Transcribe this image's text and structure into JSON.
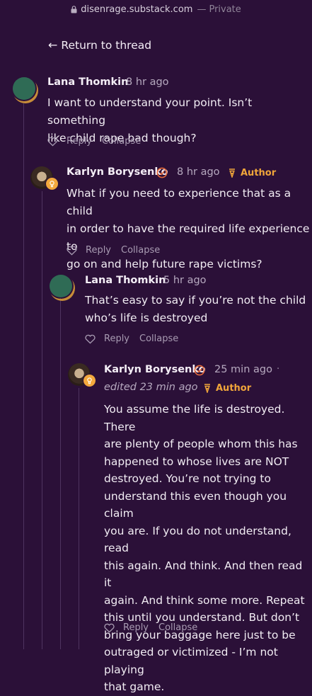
{
  "browser": {
    "domain": "disenrage.substack.com",
    "separator": "—",
    "privacy": "Private"
  },
  "nav": {
    "back_label": "Return to thread"
  },
  "comments": [
    {
      "author": "Lana Thomkin",
      "time": "8 hr ago",
      "lines": [
        "I want to understand your point. Isn’t something",
        "like child rape bad though?"
      ],
      "reply": "Reply",
      "collapse": "Collapse"
    },
    {
      "author": "Karlyn Borysenko",
      "time": "8 hr ago",
      "role": "Author",
      "lines": [
        "What if you need to experience that as a child",
        "in order to have the required life experience to",
        "go on and help future rape victims?"
      ],
      "reply": "Reply",
      "collapse": "Collapse"
    },
    {
      "author": "Lana Thomkin",
      "time": "5 hr ago",
      "lines": [
        "That’s easy to say if you’re not the child",
        "who’s life is destroyed"
      ],
      "reply": "Reply",
      "collapse": "Collapse"
    },
    {
      "author": "Karlyn Borysenko",
      "time": "25 min ago",
      "dot": "·",
      "edited": "edited 23 min ago",
      "role": "Author",
      "lines": [
        "You assume the life is destroyed. There",
        "are plenty of people whom this has",
        "happened to whose lives are NOT",
        "destroyed. You’re not trying to",
        "understand this even though you claim",
        "you are. If you do not understand, read",
        "this again. And think. And then read it",
        "again. And think some more. Repeat",
        "this until you understand. But don’t",
        "bring your baggage here just to be",
        "outraged or victimized - I’m not playing",
        "that game."
      ],
      "reply": "Reply",
      "collapse": "Collapse"
    }
  ],
  "colors": {
    "background": "#2b1038",
    "author_accent": "#f0a53a",
    "muted": "#a89bb2"
  }
}
